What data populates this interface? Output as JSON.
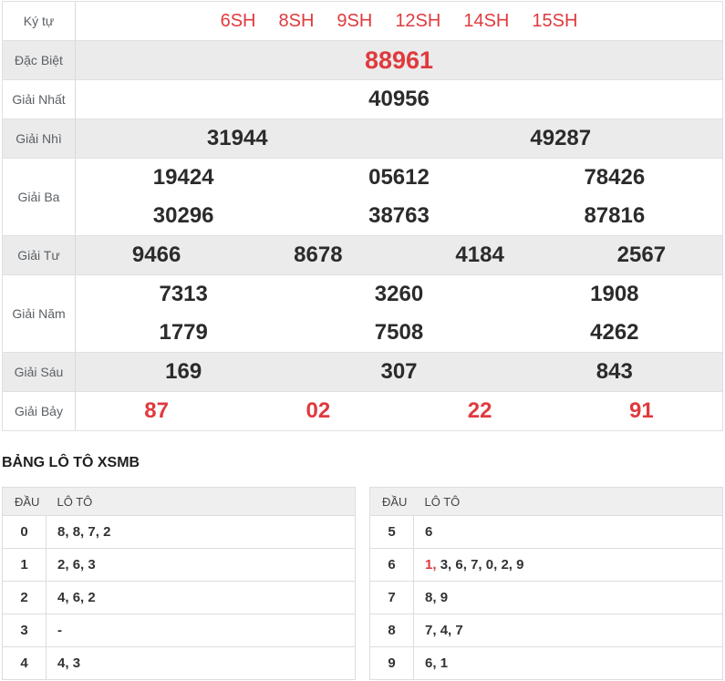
{
  "results_table": {
    "rows": [
      {
        "id": "ky-tu",
        "label": "Ký tự",
        "striped": false,
        "red": true,
        "style": "symbols",
        "lines": [
          [
            "6SH",
            "8SH",
            "9SH",
            "12SH",
            "14SH",
            "15SH"
          ]
        ]
      },
      {
        "id": "dac-biet",
        "label": "Đặc Biệt",
        "striped": true,
        "red": true,
        "style": "special",
        "lines": [
          [
            "88961"
          ]
        ]
      },
      {
        "id": "giai-nhat",
        "label": "Giải Nhất",
        "striped": false,
        "red": false,
        "style": "normal",
        "lines": [
          [
            "40956"
          ]
        ]
      },
      {
        "id": "giai-nhi",
        "label": "Giải Nhì",
        "striped": true,
        "red": false,
        "style": "normal",
        "lines": [
          [
            "31944",
            "49287"
          ]
        ]
      },
      {
        "id": "giai-ba",
        "label": "Giải Ba",
        "striped": false,
        "red": false,
        "style": "normal",
        "lines": [
          [
            "19424",
            "05612",
            "78426"
          ],
          [
            "30296",
            "38763",
            "87816"
          ]
        ]
      },
      {
        "id": "giai-tu",
        "label": "Giải Tư",
        "striped": true,
        "red": false,
        "style": "normal",
        "lines": [
          [
            "9466",
            "8678",
            "4184",
            "2567"
          ]
        ]
      },
      {
        "id": "giai-nam",
        "label": "Giải Năm",
        "striped": false,
        "red": false,
        "style": "normal",
        "lines": [
          [
            "7313",
            "3260",
            "1908"
          ],
          [
            "1779",
            "7508",
            "4262"
          ]
        ]
      },
      {
        "id": "giai-sau",
        "label": "Giải Sáu",
        "striped": true,
        "red": false,
        "style": "normal",
        "lines": [
          [
            "169",
            "307",
            "843"
          ]
        ]
      },
      {
        "id": "giai-bay",
        "label": "Giải Bảy",
        "striped": false,
        "red": true,
        "style": "normal",
        "lines": [
          [
            "87",
            "02",
            "22",
            "91"
          ]
        ]
      }
    ]
  },
  "loto_section": {
    "title": "BẢNG LÔ TÔ XSMB",
    "col_dau": "ĐẦU",
    "col_loto": "LÔ TÔ",
    "tables": [
      {
        "id": "left",
        "rows": [
          {
            "dau": "0",
            "values": [
              "8",
              "8",
              "7",
              "2"
            ],
            "red_indices": []
          },
          {
            "dau": "1",
            "values": [
              "2",
              "6",
              "3"
            ],
            "red_indices": []
          },
          {
            "dau": "2",
            "values": [
              "4",
              "6",
              "2"
            ],
            "red_indices": []
          },
          {
            "dau": "3",
            "values": [
              "-"
            ],
            "red_indices": []
          },
          {
            "dau": "4",
            "values": [
              "4",
              "3"
            ],
            "red_indices": []
          }
        ]
      },
      {
        "id": "right",
        "rows": [
          {
            "dau": "5",
            "values": [
              "6"
            ],
            "red_indices": []
          },
          {
            "dau": "6",
            "values": [
              "1",
              "3",
              "6",
              "7",
              "0",
              "2",
              "9"
            ],
            "red_indices": [
              0
            ]
          },
          {
            "dau": "7",
            "values": [
              "8",
              "9"
            ],
            "red_indices": []
          },
          {
            "dau": "8",
            "values": [
              "7",
              "4",
              "7"
            ],
            "red_indices": []
          },
          {
            "dau": "9",
            "values": [
              "6",
              "1"
            ],
            "red_indices": []
          }
        ]
      }
    ]
  },
  "colors": {
    "accent_red": "#e03a3e",
    "stripe_bg": "#ebebeb",
    "border": "#e0e0e0",
    "label_text": "#5a6066",
    "number_text": "#2b2b2b",
    "loto_header_bg": "#efefef",
    "loto_border": "#dddddd",
    "loto_text": "#333333"
  }
}
